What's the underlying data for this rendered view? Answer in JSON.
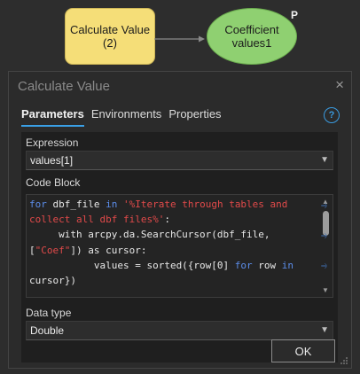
{
  "model": {
    "tool_node": {
      "line1": "Calculate Value",
      "line2": "(2)"
    },
    "variable_node": {
      "line1": "Coefficient",
      "line2": "values1"
    },
    "variable_badge": "P"
  },
  "dialog": {
    "title": "Calculate Value",
    "close_glyph": "×",
    "help_glyph": "?",
    "tabs": [
      {
        "label": "Parameters",
        "active": true
      },
      {
        "label": "Environments",
        "active": false
      },
      {
        "label": "Properties",
        "active": false
      }
    ],
    "expression": {
      "label": "Expression",
      "value": "values[1]"
    },
    "code_block": {
      "label": "Code Block",
      "lines": [
        [
          {
            "t": "for",
            "c": "kw"
          },
          {
            "t": " dbf_file "
          },
          {
            "t": "in",
            "c": "kw"
          },
          {
            "t": " "
          },
          {
            "t": "'%Iterate through tables and",
            "c": "str"
          }
        ],
        [
          {
            "t": "collect all dbf files%'",
            "c": "str"
          },
          {
            "t": ":"
          }
        ],
        [
          {
            "t": "     with arcpy.da.SearchCursor(dbf_file,"
          }
        ],
        [
          {
            "t": "["
          },
          {
            "t": "\"Coef\"",
            "c": "str"
          },
          {
            "t": "]) as cursor:"
          }
        ],
        [
          {
            "t": "           values = sorted({row[0] "
          },
          {
            "t": "for",
            "c": "kw"
          },
          {
            "t": " row "
          },
          {
            "t": "in",
            "c": "kw"
          }
        ],
        [
          {
            "t": "cursor})"
          }
        ]
      ]
    },
    "data_type": {
      "label": "Data type",
      "value": "Double"
    },
    "ok_label": "OK"
  }
}
